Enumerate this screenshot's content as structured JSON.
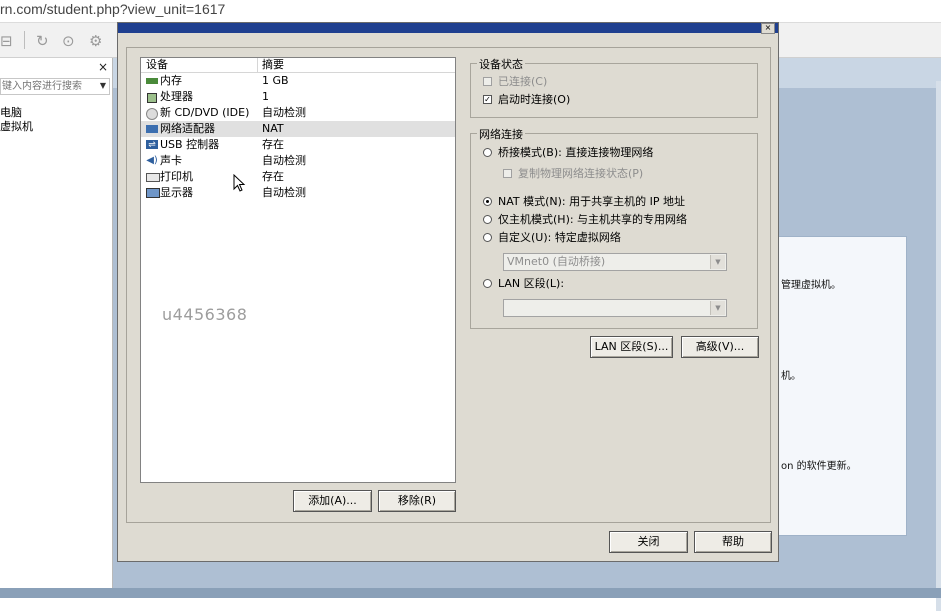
{
  "browser": {
    "url": "rn.com/student.php?view_unit=1617"
  },
  "background_app": {
    "sidebar": {
      "close_glyph": "×",
      "search_placeholder": "键入内容进行搜索",
      "tree": [
        "电脑",
        "虚拟机"
      ]
    },
    "home": {
      "line1": "管理虚拟机。",
      "line2": "机。",
      "line3": "on 的软件更新。"
    }
  },
  "dialog": {
    "close_glyph": "×",
    "device_list": {
      "headers": {
        "device": "设备",
        "summary": "摘要"
      },
      "rows": [
        {
          "icon": "memory-icon",
          "name": "内存",
          "summary": "1 GB"
        },
        {
          "icon": "processor-icon",
          "name": "处理器",
          "summary": "1"
        },
        {
          "icon": "cd-dvd-icon",
          "name": "新 CD/DVD (IDE)",
          "summary": "自动检测"
        },
        {
          "icon": "network-adapter-icon",
          "name": "网络适配器",
          "summary": "NAT",
          "selected": true
        },
        {
          "icon": "usb-icon",
          "name": "USB 控制器",
          "summary": "存在"
        },
        {
          "icon": "sound-card-icon",
          "name": "声卡",
          "summary": "自动检测"
        },
        {
          "icon": "printer-icon",
          "name": "打印机",
          "summary": "存在"
        },
        {
          "icon": "display-icon",
          "name": "显示器",
          "summary": "自动检测"
        }
      ],
      "watermark": "u4456368"
    },
    "add_button": "添加(A)...",
    "remove_button": "移除(R)",
    "device_status": {
      "title": "设备状态",
      "connected": {
        "label": "已连接(C)",
        "checked": false,
        "disabled": true
      },
      "connect_at_power_on": {
        "label": "启动时连接(O)",
        "checked": true
      }
    },
    "network_connection": {
      "title": "网络连接",
      "bridged": {
        "label": "桥接模式(B): 直接连接物理网络",
        "selected": false
      },
      "replicate": {
        "label": "复制物理网络连接状态(P)",
        "checked": false,
        "disabled": true
      },
      "nat": {
        "label": "NAT 模式(N): 用于共享主机的 IP 地址",
        "selected": true
      },
      "host_only": {
        "label": "仅主机模式(H): 与主机共享的专用网络",
        "selected": false
      },
      "custom": {
        "label": "自定义(U): 特定虚拟网络",
        "selected": false
      },
      "custom_select_value": "VMnet0 (自动桥接)",
      "lan_segment": {
        "label": "LAN 区段(L):",
        "selected": false
      },
      "lan_select_value": ""
    },
    "lan_segments_button": "LAN 区段(S)...",
    "advanced_button": "高级(V)...",
    "close_button": "关闭",
    "help_button": "帮助"
  }
}
